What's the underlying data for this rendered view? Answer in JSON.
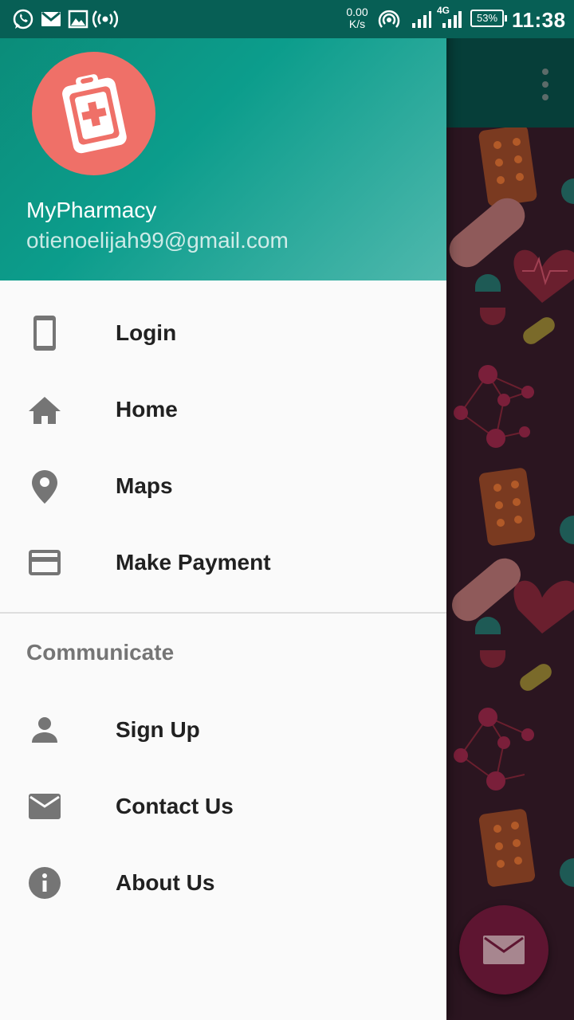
{
  "status_bar": {
    "net_speed_value": "0.00",
    "net_speed_unit": "K/s",
    "network_type": "4G",
    "battery": "53%",
    "time": "11:38",
    "icons": [
      "whatsapp-icon",
      "gmail-icon",
      "gallery-icon",
      "broadcast-icon",
      "hotspot-icon",
      "signal-icon",
      "signal-4g-icon",
      "battery-icon"
    ]
  },
  "drawer": {
    "header": {
      "app_name": "MyPharmacy",
      "email": "otienoelijah99@gmail.com",
      "logo_color": "#ef7068"
    },
    "items": [
      {
        "label": "Login",
        "icon": "phone-icon"
      },
      {
        "label": "Home",
        "icon": "home-icon"
      },
      {
        "label": "Maps",
        "icon": "location-pin-icon"
      },
      {
        "label": "Make Payment",
        "icon": "credit-card-icon"
      }
    ],
    "section_title": "Communicate",
    "section_items": [
      {
        "label": "Sign Up",
        "icon": "person-icon"
      },
      {
        "label": "Contact Us",
        "icon": "mail-icon"
      },
      {
        "label": "About Us",
        "icon": "info-icon"
      }
    ]
  },
  "background": {
    "fab_icon": "mail-icon",
    "overflow_icon": "more-vert-icon"
  },
  "colors": {
    "primary": "#0c9d8c",
    "status_bar": "#075f55",
    "drawer_bg": "#fafafa",
    "icon_gray": "#757575",
    "text_dark": "#212121",
    "fab": "#5e1531"
  }
}
